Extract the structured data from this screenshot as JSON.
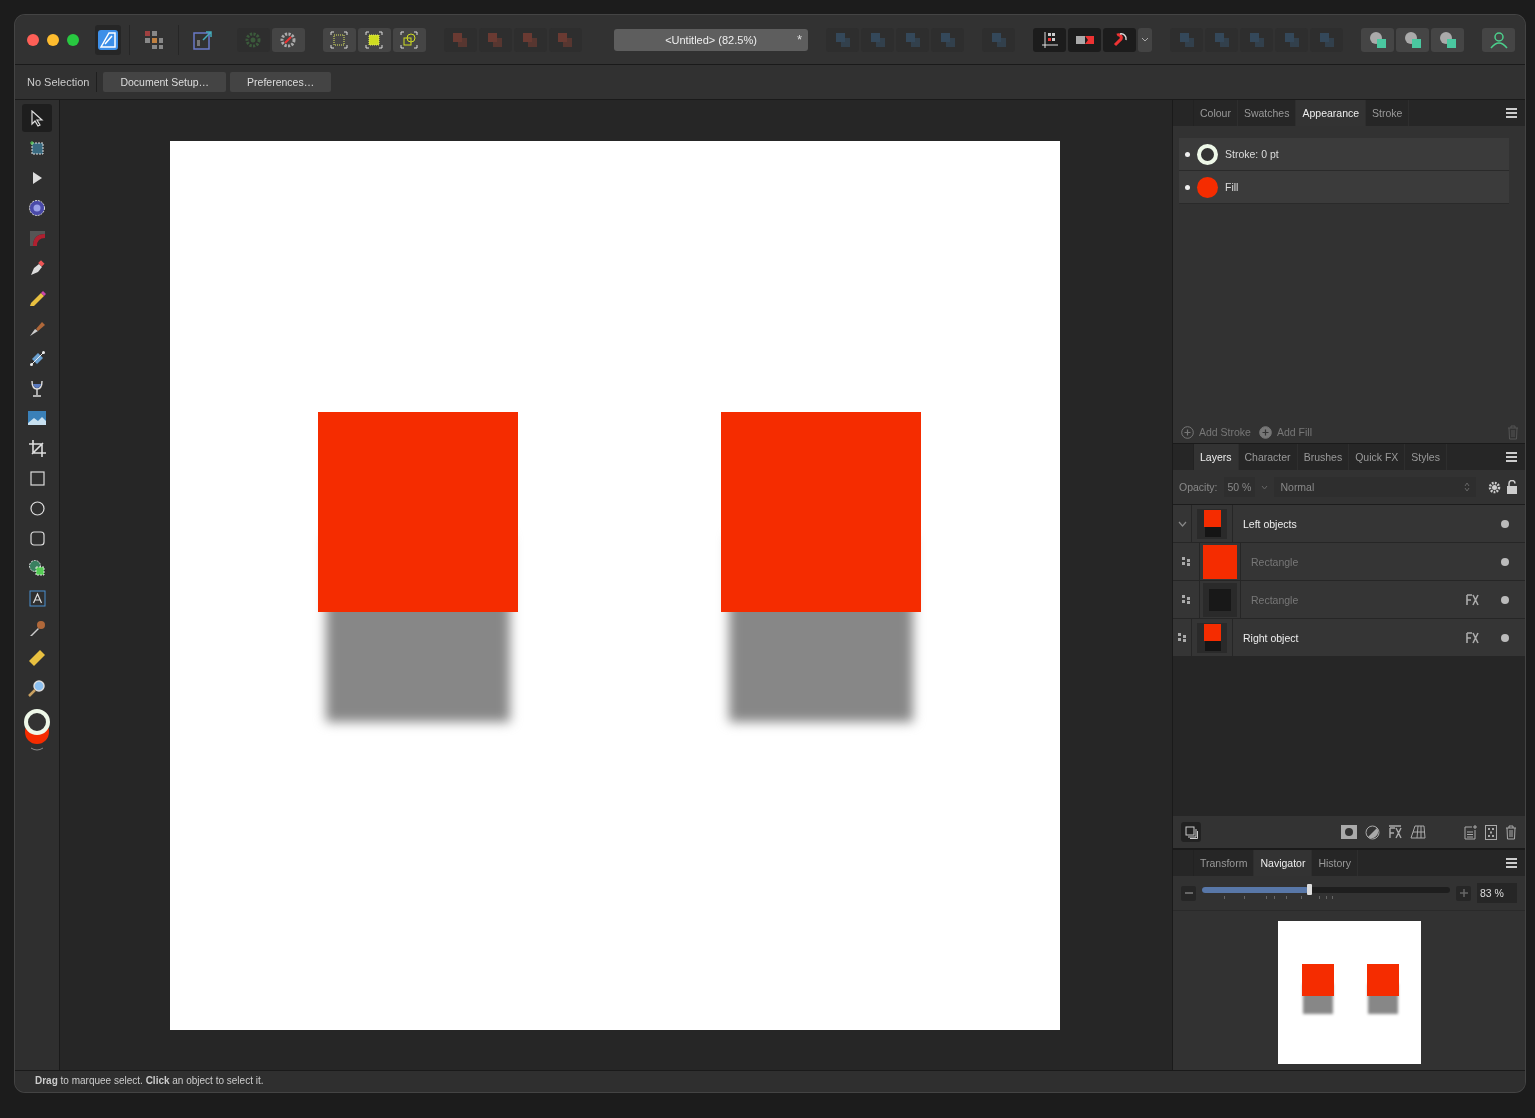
{
  "window": {
    "title": "<Untitled> (82.5%)",
    "modified_mark": "*"
  },
  "context_bar": {
    "selection": "No Selection",
    "buttons": [
      "Document Setup…",
      "Preferences…"
    ]
  },
  "tools": [
    {
      "kind": "pointer",
      "selected": true
    },
    {
      "kind": "artboard",
      "selected": false
    },
    {
      "kind": "node",
      "selected": false
    },
    {
      "kind": "contour",
      "selected": false
    },
    {
      "kind": "corner",
      "selected": false
    },
    {
      "kind": "pen",
      "selected": false
    },
    {
      "kind": "pencil",
      "selected": false
    },
    {
      "kind": "brush",
      "selected": false
    },
    {
      "kind": "gradient",
      "selected": false
    },
    {
      "kind": "transparency",
      "selected": false
    },
    {
      "kind": "image",
      "selected": false
    },
    {
      "kind": "crop",
      "selected": false
    },
    {
      "kind": "rectangle",
      "selected": false
    },
    {
      "kind": "ellipse",
      "selected": false
    },
    {
      "kind": "rounded",
      "selected": false
    },
    {
      "kind": "shapebuilder",
      "selected": false
    },
    {
      "kind": "text",
      "selected": false
    },
    {
      "kind": "picker",
      "selected": false
    },
    {
      "kind": "measure",
      "selected": false
    },
    {
      "kind": "zoom",
      "selected": false
    }
  ],
  "appearance_panel": {
    "tabs": [
      {
        "label": "Colour",
        "selected": false
      },
      {
        "label": "Swatches",
        "selected": false
      },
      {
        "label": "Appearance",
        "selected": true
      },
      {
        "label": "Stroke",
        "selected": false
      }
    ],
    "rows": [
      {
        "kind": "stroke",
        "label": "Stroke: 0 pt",
        "color": "#eef8e8"
      },
      {
        "kind": "fill",
        "label": "Fill",
        "color": "#f52c00"
      }
    ],
    "actions": [
      "Add Stroke",
      "Add Fill"
    ]
  },
  "layers_panel": {
    "tabs": [
      {
        "label": "Layers",
        "selected": true
      },
      {
        "label": "Character",
        "selected": false
      },
      {
        "label": "Brushes",
        "selected": false
      },
      {
        "label": "Quick FX",
        "selected": false
      },
      {
        "label": "Styles",
        "selected": false
      }
    ],
    "opacity_label": "Opacity:",
    "opacity": "50 %",
    "blend_mode": "Normal",
    "layers": [
      {
        "name": "Left objects",
        "kind": "composite",
        "fx": false,
        "expanded": true,
        "children": [
          {
            "name": "Rectangle",
            "kind": "fill",
            "fx": false
          },
          {
            "name": "Rectangle",
            "kind": "shadow",
            "fx": true
          }
        ]
      },
      {
        "name": "Right object",
        "kind": "composite",
        "fx": true
      }
    ]
  },
  "navigator_panel": {
    "tabs": [
      {
        "label": "Transform",
        "selected": false
      },
      {
        "label": "Navigator",
        "selected": true
      },
      {
        "label": "History",
        "selected": false
      }
    ],
    "level": 0.43,
    "zoom": "83 %"
  },
  "status_bar": "**Drag** to marquee select. **Click** an object to select it."
}
